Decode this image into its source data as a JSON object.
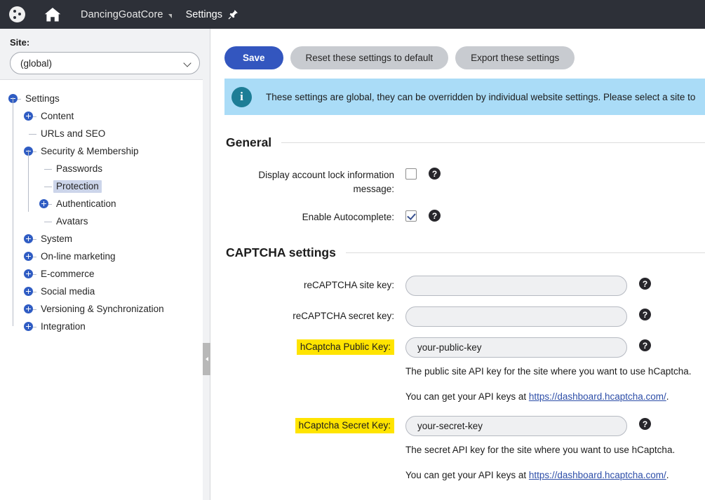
{
  "topbar": {
    "logo_icon": "kentico-dots-logo-icon",
    "home_icon": "home-icon",
    "site_name": "DancingGoatCore",
    "site_caret_icon": "caret-down-icon",
    "app_tab": "Settings",
    "pin_icon": "pin-icon"
  },
  "sidebar": {
    "site_label": "Site:",
    "site_selected": "(global)",
    "site_options": [
      "(global)"
    ],
    "chevron_icon": "chevron-down-icon",
    "tree": [
      {
        "label": "Settings",
        "depth": 0,
        "toggle": "minus",
        "selected": false
      },
      {
        "label": "Content",
        "depth": 1,
        "toggle": "plus",
        "selected": false
      },
      {
        "label": "URLs and SEO",
        "depth": 1,
        "toggle": "none",
        "selected": false
      },
      {
        "label": "Security & Membership",
        "depth": 1,
        "toggle": "minus",
        "selected": false
      },
      {
        "label": "Passwords",
        "depth": 2,
        "toggle": "none",
        "selected": false
      },
      {
        "label": "Protection",
        "depth": 2,
        "toggle": "none",
        "selected": true
      },
      {
        "label": "Authentication",
        "depth": 2,
        "toggle": "plus",
        "selected": false
      },
      {
        "label": "Avatars",
        "depth": 2,
        "toggle": "none",
        "selected": false
      },
      {
        "label": "System",
        "depth": 1,
        "toggle": "plus",
        "selected": false
      },
      {
        "label": "On-line marketing",
        "depth": 1,
        "toggle": "plus",
        "selected": false
      },
      {
        "label": "E-commerce",
        "depth": 1,
        "toggle": "plus",
        "selected": false
      },
      {
        "label": "Social media",
        "depth": 1,
        "toggle": "plus",
        "selected": false
      },
      {
        "label": "Versioning & Synchronization",
        "depth": 1,
        "toggle": "plus",
        "selected": false
      },
      {
        "label": "Integration",
        "depth": 1,
        "toggle": "plus",
        "selected": false
      }
    ]
  },
  "splitter": {
    "collapse_icon": "collapse-left-icon"
  },
  "toolbar": {
    "save_label": "Save",
    "reset_label": "Reset these settings to default",
    "export_label": "Export these settings"
  },
  "banner": {
    "icon": "info-icon",
    "text": "These settings are global, they can be overridden by individual website settings. Please select a site to"
  },
  "general": {
    "title": "General",
    "display_lock_label": "Display account lock information message:",
    "display_lock_checked": false,
    "autocomplete_label": "Enable Autocomplete:",
    "autocomplete_checked": true,
    "help_icon": "help-icon"
  },
  "captcha": {
    "title": "CAPTCHA settings",
    "recaptcha_site_label": "reCAPTCHA site key:",
    "recaptcha_site_value": "",
    "recaptcha_secret_label": "reCAPTCHA secret key:",
    "recaptcha_secret_value": "",
    "hcaptcha_public_label": "hCaptcha Public Key:",
    "hcaptcha_public_value": "your-public-key",
    "hcaptcha_public_help1": "The public site API key for the site where you want to use hCaptcha.",
    "hcaptcha_public_help2_pre": "You can get your API keys at ",
    "hcaptcha_public_help2_link": "https://dashboard.hcaptcha.com/",
    "hcaptcha_public_help2_post": ".",
    "hcaptcha_secret_label": "hCaptcha Secret Key:",
    "hcaptcha_secret_value": "your-secret-key",
    "hcaptcha_secret_help1": "The secret API key for the site where you want to use hCaptcha.",
    "hcaptcha_secret_help2_pre": "You can get your API keys at ",
    "hcaptcha_secret_help2_link": "https://dashboard.hcaptcha.com/",
    "hcaptcha_secret_help2_post": ".",
    "help_icon": "help-icon",
    "highlight_color": "#ffe400"
  }
}
